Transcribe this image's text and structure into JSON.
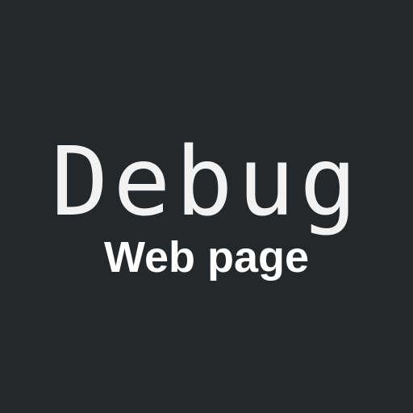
{
  "title": "Debug",
  "subtitle": "Web page",
  "colors": {
    "background": "#25282b",
    "title": "#f2f2f2",
    "subtitle": "#ffffff"
  }
}
